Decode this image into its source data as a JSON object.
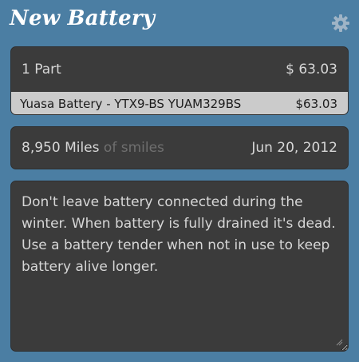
{
  "header": {
    "title": "New Battery",
    "settings_icon": "gear-icon"
  },
  "parts": {
    "count_label": "1 Part",
    "total": "$ 63.03",
    "items": [
      {
        "name": "Yuasa Battery - YTX9-BS YUAM329BS",
        "price": "$63.03"
      }
    ]
  },
  "mileage": {
    "miles": "8,950 Miles",
    "suffix": " of smiles",
    "date": "Jun 20, 2012"
  },
  "notes": {
    "text": "Don't leave battery connected during the winter. When battery is fully drained it's dead. Use a battery tender when not in use to keep battery alive longer."
  },
  "colors": {
    "background": "#4b7ea3",
    "card": "#3b3b3b",
    "part_row": "#cbcbcb",
    "text": "#d7d7d7",
    "muted": "#6f6f6f"
  }
}
